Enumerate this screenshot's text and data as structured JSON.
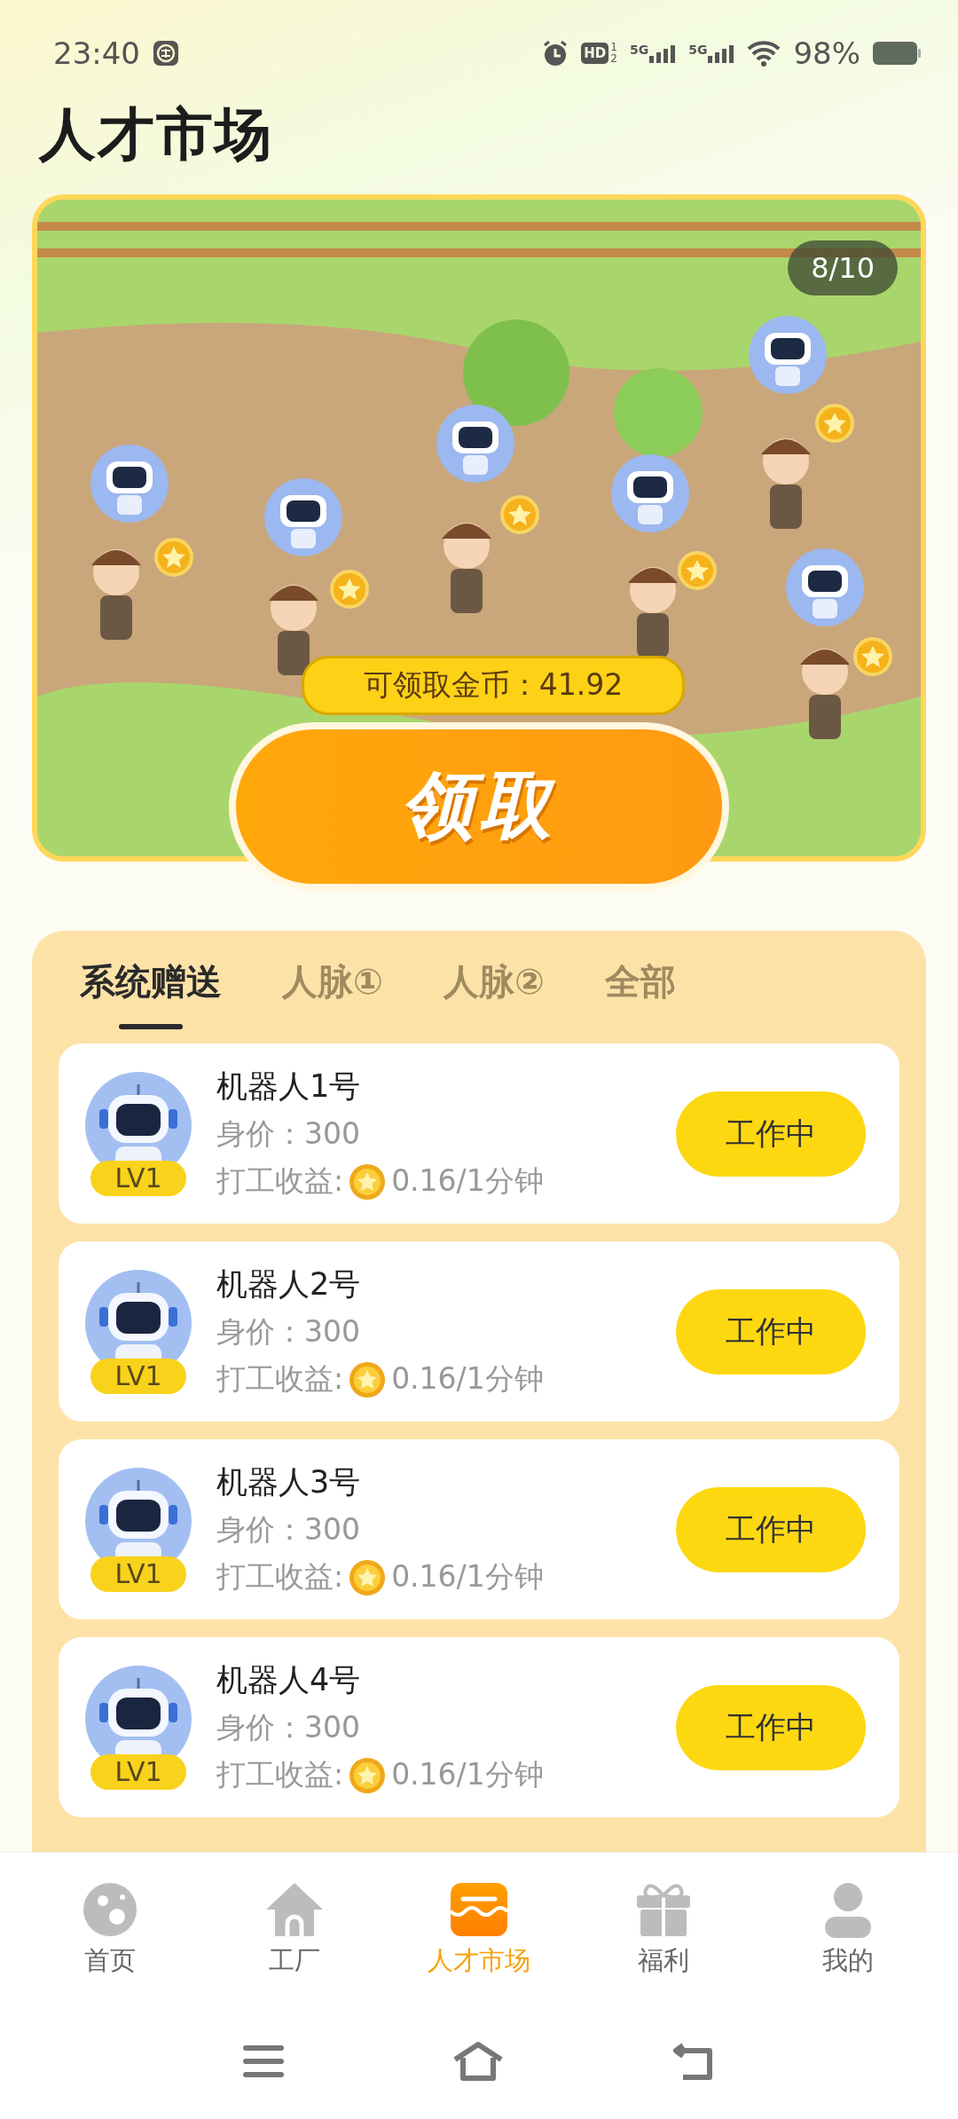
{
  "status_bar": {
    "time": "23:40",
    "hd_label": "HD",
    "sim_slots": [
      "1",
      "2"
    ],
    "networks": [
      "5G",
      "5G"
    ],
    "battery": "98%"
  },
  "title": "人才市场",
  "scene": {
    "counter": "8/10",
    "coins_label": "可领取金币：41.92",
    "claim_button": "领取"
  },
  "tabs": [
    {
      "label": "系统赠送",
      "selected": true
    },
    {
      "label": "人脉①",
      "selected": false
    },
    {
      "label": "人脉②",
      "selected": false
    },
    {
      "label": "全部",
      "selected": false
    }
  ],
  "robots": [
    {
      "name": "机器人1号",
      "level_badge": "LV1",
      "price": "身价：300",
      "income_label": "打工收益:",
      "income": "0.16/1分钟",
      "status": "工作中"
    },
    {
      "name": "机器人2号",
      "level_badge": "LV1",
      "price": "身价：300",
      "income_label": "打工收益:",
      "income": "0.16/1分钟",
      "status": "工作中"
    },
    {
      "name": "机器人3号",
      "level_badge": "LV1",
      "price": "身价：300",
      "income_label": "打工收益:",
      "income": "0.16/1分钟",
      "status": "工作中"
    },
    {
      "name": "机器人4号",
      "level_badge": "LV1",
      "price": "身价：300",
      "income_label": "打工收益:",
      "income": "0.16/1分钟",
      "status": "工作中"
    }
  ],
  "bottom_nav": [
    {
      "label": "首页",
      "selected": false
    },
    {
      "label": "工厂",
      "selected": false
    },
    {
      "label": "人才市场",
      "selected": true
    },
    {
      "label": "福利",
      "selected": false
    },
    {
      "label": "我的",
      "selected": false
    }
  ]
}
